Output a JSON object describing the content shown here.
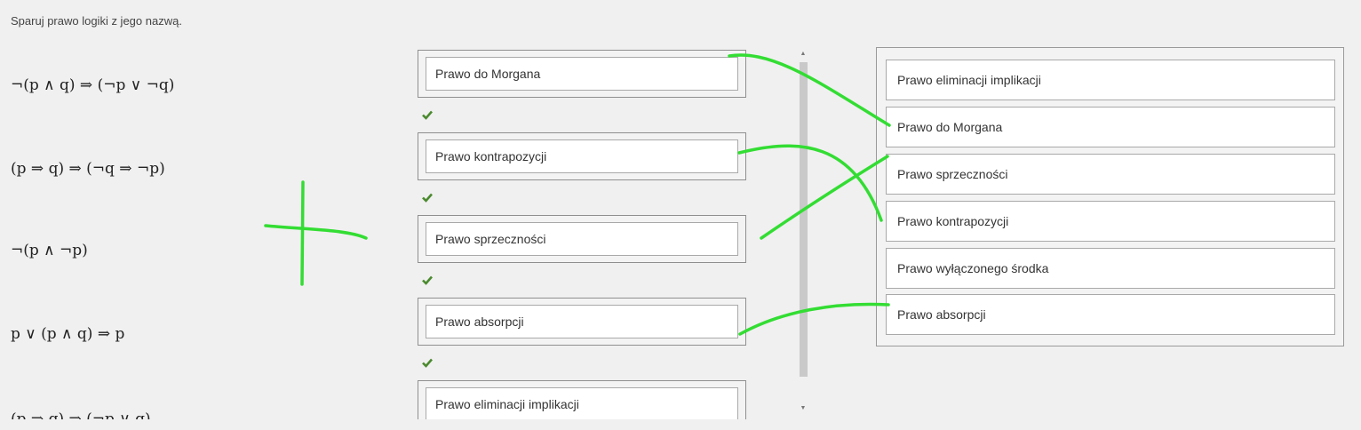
{
  "instruction": "Sparuj prawo logiki z jego nazwą.",
  "formulas": [
    "¬(p ∧ q) ⇒ (¬p ∨ ¬q)",
    "(p ⇒ q) ⇒ (¬q ⇒ ¬p)",
    "¬(p ∧ ¬p)",
    "p ∨ (p ∧ q) ⇒ p",
    "(p ⇒ q) ⇒ (¬p ∨ q)"
  ],
  "answers": [
    {
      "label": "Prawo do Morgana",
      "status": "correct"
    },
    {
      "label": "Prawo kontrapozycji",
      "status": "correct"
    },
    {
      "label": "Prawo sprzeczności",
      "status": "correct"
    },
    {
      "label": "Prawo absorpcji",
      "status": "correct"
    },
    {
      "label": "Prawo eliminacji implikacji",
      "status": "correct"
    }
  ],
  "pool": [
    "Prawo eliminacji implikacji",
    "Prawo do Morgana",
    "Prawo sprzeczności",
    "Prawo kontrapozycji",
    "Prawo wyłączonego środka",
    "Prawo absorpcji"
  ],
  "colors": {
    "check": "#4a8a2e",
    "annotation": "#33dd33"
  },
  "icons": {
    "check": "check-icon",
    "scroll_up": "scroll-up-arrow-icon",
    "scroll_down": "scroll-down-arrow-icon"
  }
}
